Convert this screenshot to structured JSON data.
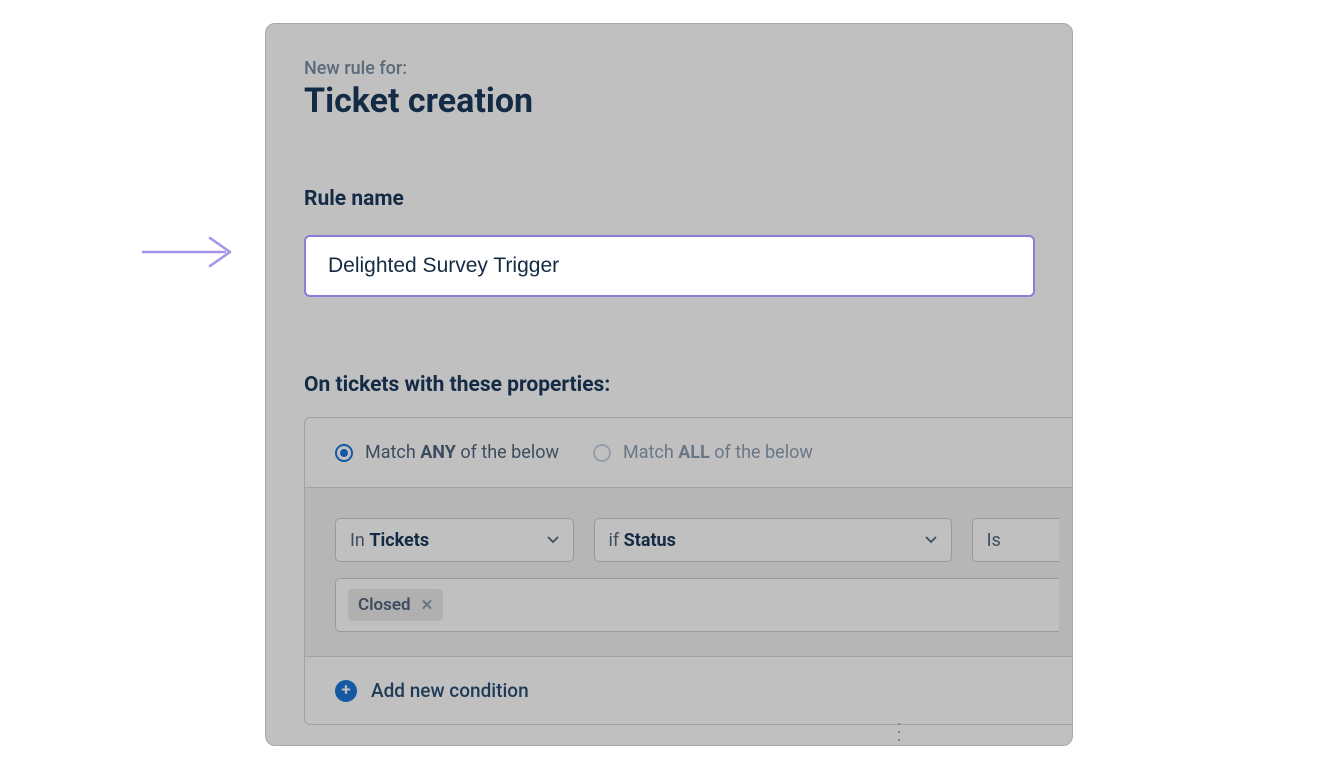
{
  "header": {
    "subtitle": "New rule for:",
    "title": "Ticket creation"
  },
  "rule_name": {
    "label": "Rule name",
    "value": "Delighted Survey Trigger"
  },
  "properties": {
    "section_label": "On tickets with these properties:",
    "match_any": {
      "prefix": "Match ",
      "bold": "ANY",
      "suffix": " of the below"
    },
    "match_all": {
      "prefix": "Match ",
      "bold": "ALL",
      "suffix": " of the below"
    },
    "selected": "any",
    "condition": {
      "scope_prefix": "In ",
      "scope_value": "Tickets",
      "field_prefix": "if ",
      "field_value": "Status",
      "operator": "Is",
      "chip": "Closed"
    },
    "add_label": "Add new condition"
  },
  "colors": {
    "accent": "#1558a3",
    "input_border": "#8b7dd8",
    "panel_bg": "#c0c0c0"
  }
}
